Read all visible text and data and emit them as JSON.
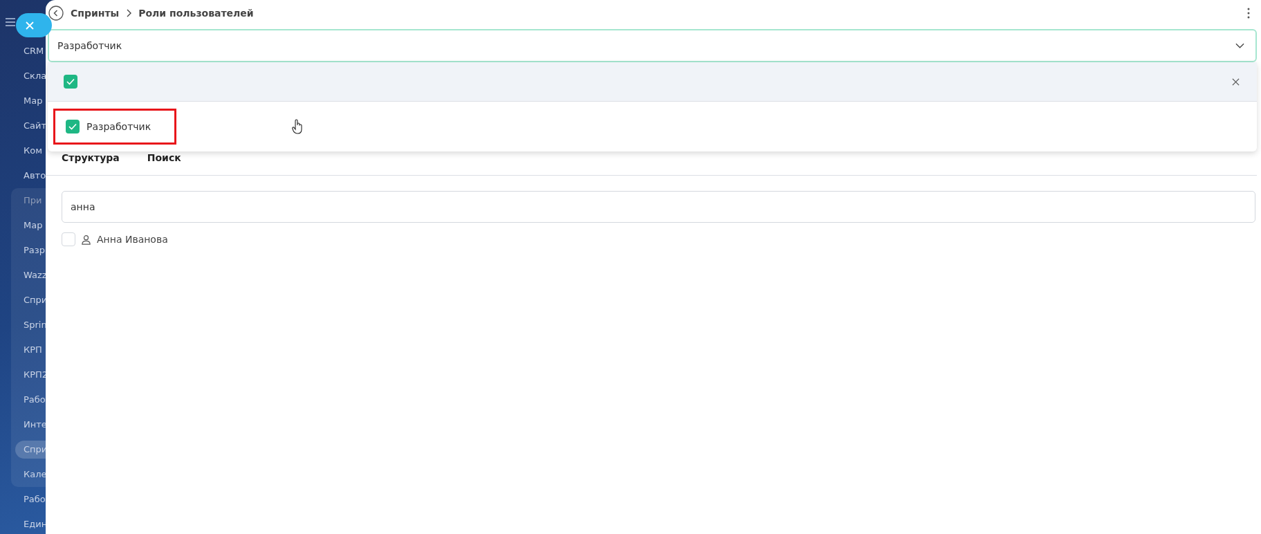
{
  "sidebar": {
    "items_top": [
      {
        "label": "CRM",
        "selected": false
      },
      {
        "label": "Скла",
        "selected": false
      },
      {
        "label": "Мар",
        "selected": false
      },
      {
        "label": "Сайт",
        "selected": false
      },
      {
        "label": "Ком",
        "selected": false
      },
      {
        "label": "Авто",
        "selected": false
      }
    ],
    "group": {
      "header": "При",
      "items": [
        {
          "label": "Мар",
          "selected": false
        },
        {
          "label": "Разр",
          "selected": false
        },
        {
          "label": "Wazz",
          "selected": false
        },
        {
          "label": "Спри",
          "selected": false
        },
        {
          "label": "Sprin",
          "selected": false
        },
        {
          "label": "КРП",
          "selected": false
        },
        {
          "label": "КРП2",
          "selected": false
        },
        {
          "label": "Рабо",
          "selected": false
        },
        {
          "label": "Инте",
          "selected": false
        },
        {
          "label": "Спри",
          "selected": true
        },
        {
          "label": "Кале",
          "selected": false
        }
      ]
    },
    "items_bottom": [
      {
        "label": "Рабо",
        "selected": false
      },
      {
        "label": "Един",
        "selected": false
      }
    ]
  },
  "breadcrumb": [
    "Спринты",
    "Роли пользователей"
  ],
  "select": {
    "value": "Разработчик"
  },
  "dropdown": {
    "select_all_checked": true,
    "options": [
      {
        "label": "Разработчик",
        "checked": true,
        "highlighted": true
      }
    ]
  },
  "tabs": [
    {
      "label": "Структура"
    },
    {
      "label": "Поиск"
    }
  ],
  "search": {
    "value": "анна"
  },
  "results": [
    {
      "name": "Анна Иванова",
      "checked": false
    }
  ]
}
